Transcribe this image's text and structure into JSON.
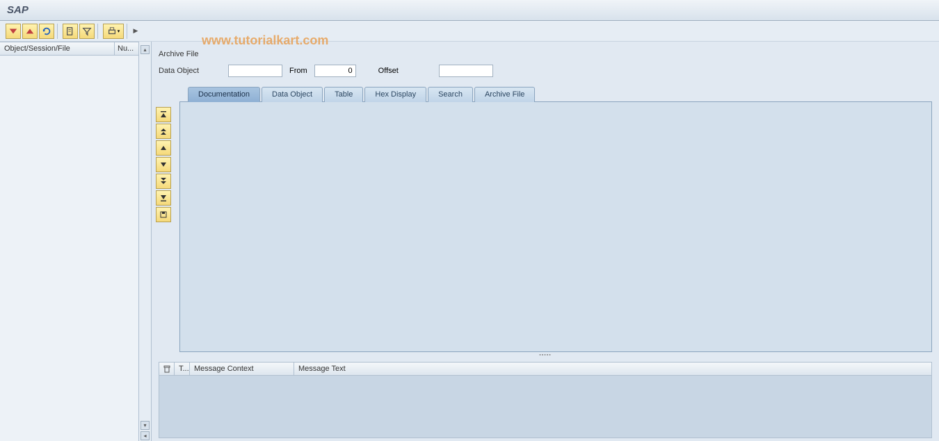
{
  "title": "SAP",
  "watermark": "www.tutorialkart.com",
  "toolbar_icons": {
    "i1": "expand",
    "i2": "collapse",
    "i3": "refresh",
    "i4": "find",
    "i5": "filter",
    "i6": "print"
  },
  "tree": {
    "col1": "Object/Session/File",
    "col2": "Nu..."
  },
  "fields": {
    "archive_file_label": "Archive File",
    "archive_file_value": "",
    "data_object_label": "Data Object",
    "data_object_value": "",
    "from_label": "From",
    "from_value": "0",
    "offset_label": "Offset",
    "offset_value": ""
  },
  "tabs": [
    {
      "label": "Documentation",
      "active": true
    },
    {
      "label": "Data Object",
      "active": false
    },
    {
      "label": "Table",
      "active": false
    },
    {
      "label": "Hex Display",
      "active": false
    },
    {
      "label": "Search",
      "active": false
    },
    {
      "label": "Archive File",
      "active": false
    }
  ],
  "messages": {
    "col_t": "T...",
    "col_context": "Message Context",
    "col_text": "Message Text"
  }
}
